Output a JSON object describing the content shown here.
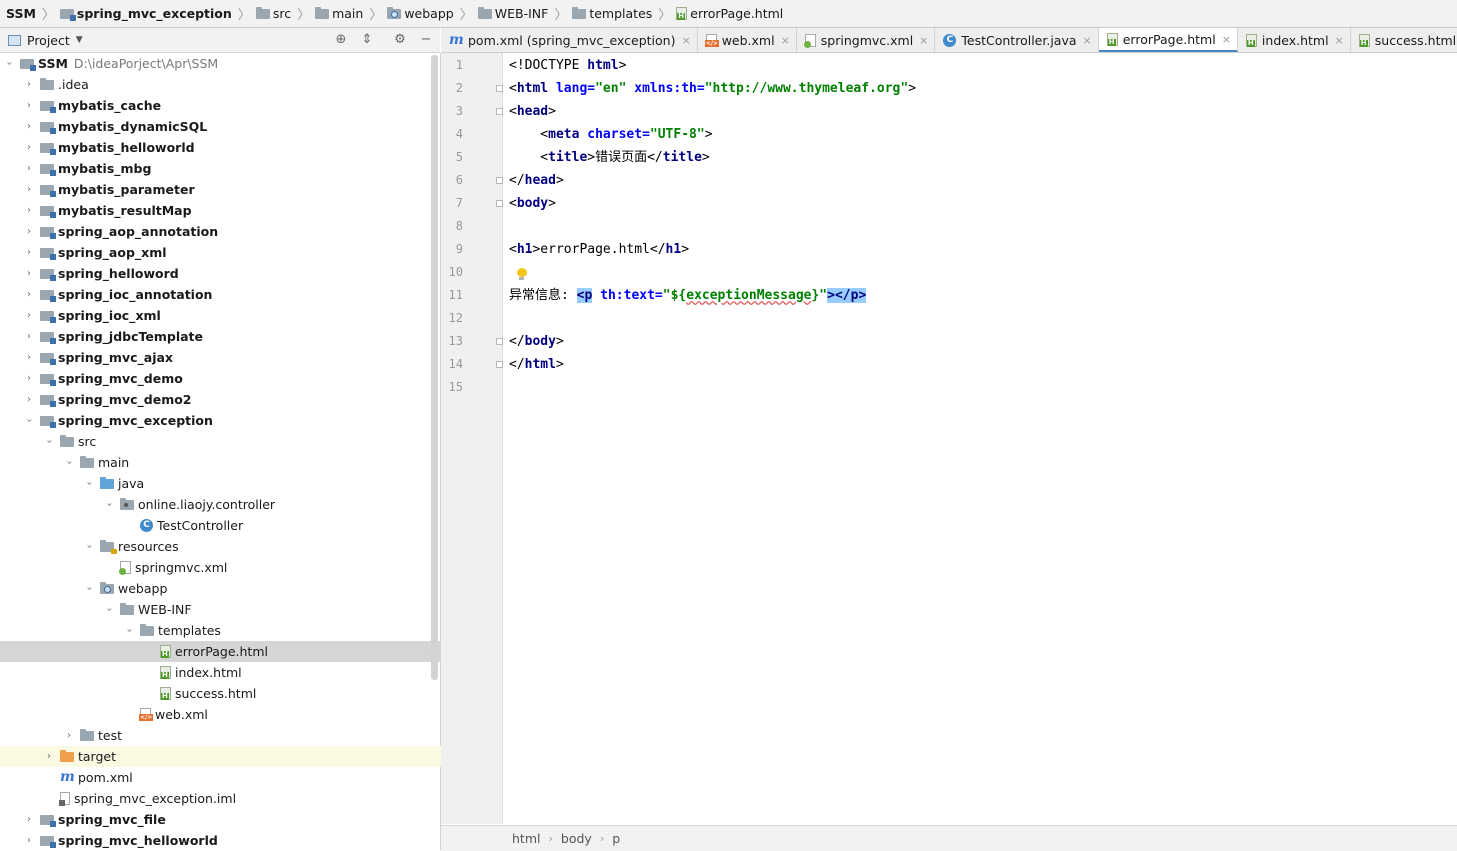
{
  "navbar": {
    "crumbs": [
      {
        "label": "SSM",
        "icon": "module-folder-icon",
        "bold": true
      },
      {
        "label": "spring_mvc_exception",
        "icon": "module-folder-icon",
        "bold": true
      },
      {
        "label": "src",
        "icon": "folder-icon",
        "bold": false
      },
      {
        "label": "main",
        "icon": "folder-icon",
        "bold": false
      },
      {
        "label": "webapp",
        "icon": "web-folder-icon",
        "bold": false
      },
      {
        "label": "WEB-INF",
        "icon": "folder-icon",
        "bold": false
      },
      {
        "label": "templates",
        "icon": "folder-icon",
        "bold": false
      },
      {
        "label": "errorPage.html",
        "icon": "html-file-icon",
        "bold": false
      }
    ]
  },
  "project_panel": {
    "title": "Project",
    "dropdown_icon": "triangle-down",
    "tools": [
      "locate-icon",
      "collapse-icon",
      "gear-icon",
      "minimize-icon"
    ]
  },
  "tree": [
    {
      "level": 0,
      "label": "SSM",
      "path": "D:\\ideaPorject\\Apr\\SSM",
      "icon": "module-folder-icon",
      "arrow": "open",
      "bold": true
    },
    {
      "level": 1,
      "label": ".idea",
      "icon": "folder-icon",
      "arrow": "closed"
    },
    {
      "level": 1,
      "label": "mybatis_cache",
      "icon": "module-folder-icon",
      "arrow": "closed",
      "bold": true
    },
    {
      "level": 1,
      "label": "mybatis_dynamicSQL",
      "icon": "module-folder-icon",
      "arrow": "closed",
      "bold": true
    },
    {
      "level": 1,
      "label": "mybatis_helloworld",
      "icon": "module-folder-icon",
      "arrow": "closed",
      "bold": true
    },
    {
      "level": 1,
      "label": "mybatis_mbg",
      "icon": "module-folder-icon",
      "arrow": "closed",
      "bold": true
    },
    {
      "level": 1,
      "label": "mybatis_parameter",
      "icon": "module-folder-icon",
      "arrow": "closed",
      "bold": true
    },
    {
      "level": 1,
      "label": "mybatis_resultMap",
      "icon": "module-folder-icon",
      "arrow": "closed",
      "bold": true
    },
    {
      "level": 1,
      "label": "spring_aop_annotation",
      "icon": "module-folder-icon",
      "arrow": "closed",
      "bold": true
    },
    {
      "level": 1,
      "label": "spring_aop_xml",
      "icon": "module-folder-icon",
      "arrow": "closed",
      "bold": true
    },
    {
      "level": 1,
      "label": "spring_helloword",
      "icon": "module-folder-icon",
      "arrow": "closed",
      "bold": true
    },
    {
      "level": 1,
      "label": "spring_ioc_annotation",
      "icon": "module-folder-icon",
      "arrow": "closed",
      "bold": true
    },
    {
      "level": 1,
      "label": "spring_ioc_xml",
      "icon": "module-folder-icon",
      "arrow": "closed",
      "bold": true
    },
    {
      "level": 1,
      "label": "spring_jdbcTemplate",
      "icon": "module-folder-icon",
      "arrow": "closed",
      "bold": true
    },
    {
      "level": 1,
      "label": "spring_mvc_ajax",
      "icon": "module-folder-icon",
      "arrow": "closed",
      "bold": true
    },
    {
      "level": 1,
      "label": "spring_mvc_demo",
      "icon": "module-folder-icon",
      "arrow": "closed",
      "bold": true
    },
    {
      "level": 1,
      "label": "spring_mvc_demo2",
      "icon": "module-folder-icon",
      "arrow": "closed",
      "bold": true
    },
    {
      "level": 1,
      "label": "spring_mvc_exception",
      "icon": "module-folder-icon",
      "arrow": "open",
      "bold": true
    },
    {
      "level": 2,
      "label": "src",
      "icon": "folder-icon",
      "arrow": "open"
    },
    {
      "level": 3,
      "label": "main",
      "icon": "folder-icon",
      "arrow": "open"
    },
    {
      "level": 4,
      "label": "java",
      "icon": "source-folder-icon",
      "arrow": "open"
    },
    {
      "level": 5,
      "label": "online.liaojy.controller",
      "icon": "package-icon",
      "arrow": "open"
    },
    {
      "level": 6,
      "label": "TestController",
      "icon": "class-icon",
      "arrow": "none"
    },
    {
      "level": 4,
      "label": "resources",
      "icon": "resources-folder-icon",
      "arrow": "open"
    },
    {
      "level": 5,
      "label": "springmvc.xml",
      "icon": "spring-xml-icon",
      "arrow": "none"
    },
    {
      "level": 4,
      "label": "webapp",
      "icon": "web-folder-icon",
      "arrow": "open"
    },
    {
      "level": 5,
      "label": "WEB-INF",
      "icon": "folder-icon",
      "arrow": "open"
    },
    {
      "level": 6,
      "label": "templates",
      "icon": "folder-icon",
      "arrow": "open"
    },
    {
      "level": 7,
      "label": "errorPage.html",
      "icon": "html-file-icon",
      "arrow": "none",
      "selected": true
    },
    {
      "level": 7,
      "label": "index.html",
      "icon": "html-file-icon",
      "arrow": "none"
    },
    {
      "level": 7,
      "label": "success.html",
      "icon": "html-file-icon",
      "arrow": "none"
    },
    {
      "level": 6,
      "label": "web.xml",
      "icon": "xml-file-icon",
      "arrow": "none"
    },
    {
      "level": 3,
      "label": "test",
      "icon": "folder-icon",
      "arrow": "closed"
    },
    {
      "level": 2,
      "label": "target",
      "icon": "excluded-folder-icon",
      "arrow": "closed",
      "highlight": true
    },
    {
      "level": 2,
      "label": "pom.xml",
      "icon": "maven-icon",
      "arrow": "none"
    },
    {
      "level": 2,
      "label": "spring_mvc_exception.iml",
      "icon": "iml-file-icon",
      "arrow": "none"
    },
    {
      "level": 1,
      "label": "spring_mvc_file",
      "icon": "module-folder-icon",
      "arrow": "closed",
      "bold": true
    },
    {
      "level": 1,
      "label": "spring_mvc_helloworld",
      "icon": "module-folder-icon",
      "arrow": "closed",
      "bold": true
    }
  ],
  "tabs": [
    {
      "label": "pom.xml (spring_mvc_exception)",
      "icon": "maven-icon",
      "active": false
    },
    {
      "label": "web.xml",
      "icon": "xml-file-icon",
      "active": false
    },
    {
      "label": "springmvc.xml",
      "icon": "spring-xml-icon",
      "active": false
    },
    {
      "label": "TestController.java",
      "icon": "class-icon",
      "active": false
    },
    {
      "label": "errorPage.html",
      "icon": "html-file-icon",
      "active": true
    },
    {
      "label": "index.html",
      "icon": "html-file-icon",
      "active": false
    },
    {
      "label": "success.html",
      "icon": "html-file-icon",
      "active": false
    }
  ],
  "tab_close_glyph": "×",
  "editor": {
    "current_line": 11,
    "lines": [
      [
        {
          "t": "tx",
          "v": "<!DOCTYPE "
        },
        {
          "t": "tg",
          "v": "html"
        },
        {
          "t": "tx",
          "v": ">"
        }
      ],
      [
        {
          "t": "tx",
          "v": "<"
        },
        {
          "t": "tg",
          "v": "html "
        },
        {
          "t": "at",
          "v": "lang="
        },
        {
          "t": "av",
          "v": "\"en\" "
        },
        {
          "t": "at",
          "v": "xmlns:th="
        },
        {
          "t": "av",
          "v": "\"http://www.thymeleaf.org\""
        },
        {
          "t": "tx",
          "v": ">"
        }
      ],
      [
        {
          "t": "tx",
          "v": "<"
        },
        {
          "t": "tg",
          "v": "head"
        },
        {
          "t": "tx",
          "v": ">"
        }
      ],
      [
        {
          "t": "tx",
          "v": "    <"
        },
        {
          "t": "tg",
          "v": "meta "
        },
        {
          "t": "at",
          "v": "charset="
        },
        {
          "t": "av",
          "v": "\"UTF-8\""
        },
        {
          "t": "tx",
          "v": ">"
        }
      ],
      [
        {
          "t": "tx",
          "v": "    <"
        },
        {
          "t": "tg",
          "v": "title"
        },
        {
          "t": "tx",
          "v": ">错误页面</"
        },
        {
          "t": "tg",
          "v": "title"
        },
        {
          "t": "tx",
          "v": ">"
        }
      ],
      [
        {
          "t": "tx",
          "v": "</"
        },
        {
          "t": "tg",
          "v": "head"
        },
        {
          "t": "tx",
          "v": ">"
        }
      ],
      [
        {
          "t": "tx",
          "v": "<"
        },
        {
          "t": "tg",
          "v": "body"
        },
        {
          "t": "tx",
          "v": ">"
        }
      ],
      [],
      [
        {
          "t": "tx",
          "v": "<"
        },
        {
          "t": "tg",
          "v": "h1"
        },
        {
          "t": "tx",
          "v": ">errorPage.html</"
        },
        {
          "t": "tg",
          "v": "h1"
        },
        {
          "t": "tx",
          "v": ">"
        }
      ],
      [],
      [
        {
          "t": "tx",
          "v": "异常信息: "
        },
        {
          "t": "tg",
          "v": "<p",
          "hl": true
        },
        {
          "t": "tx",
          "v": " "
        },
        {
          "t": "at",
          "v": "th:text="
        },
        {
          "t": "av",
          "v": "\"${"
        },
        {
          "t": "av",
          "v": "exceptionMessage",
          "sq": true
        },
        {
          "t": "av",
          "v": "}\""
        },
        {
          "t": "tg",
          "v": ">",
          "hl": true
        },
        {
          "t": "tg",
          "v": "</p>",
          "hl": true
        }
      ],
      [],
      [
        {
          "t": "tx",
          "v": "</"
        },
        {
          "t": "tg",
          "v": "body"
        },
        {
          "t": "tx",
          "v": ">"
        }
      ],
      [
        {
          "t": "tx",
          "v": "</"
        },
        {
          "t": "tg",
          "v": "html"
        },
        {
          "t": "tx",
          "v": ">"
        }
      ],
      []
    ],
    "fold_lines": [
      2,
      3,
      6,
      7,
      13,
      14
    ],
    "intention_icon": "lightbulb-icon"
  },
  "status_breadcrumb": [
    "html",
    "body",
    "p"
  ]
}
